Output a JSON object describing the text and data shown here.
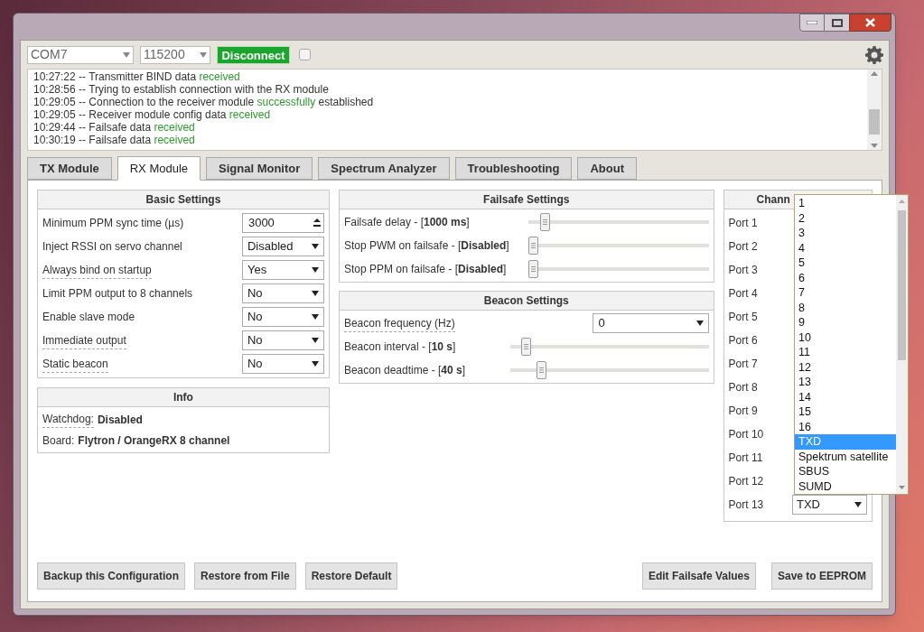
{
  "toolbar": {
    "port": "COM7",
    "baud": "115200",
    "connect_button": "Disconnect",
    "checkbox": {
      "checked": false
    }
  },
  "log": [
    [
      {
        "text": "10:27:22 -- Transmitter BIND data ",
        "kind": "plain"
      },
      {
        "text": "received",
        "kind": "ok"
      }
    ],
    [
      {
        "text": "10:28:56 -- Trying to establish connection with the RX module",
        "kind": "plain"
      }
    ],
    [
      {
        "text": "10:29:05 -- Connection to the receiver module ",
        "kind": "plain"
      },
      {
        "text": "successfully",
        "kind": "ok"
      },
      {
        "text": " established",
        "kind": "plain"
      }
    ],
    [
      {
        "text": "10:29:05 -- Receiver module config data ",
        "kind": "plain"
      },
      {
        "text": "received",
        "kind": "ok"
      }
    ],
    [
      {
        "text": "10:29:44 -- Failsafe data ",
        "kind": "plain"
      },
      {
        "text": "received",
        "kind": "ok"
      }
    ],
    [
      {
        "text": "10:30:19 -- Failsafe data ",
        "kind": "plain"
      },
      {
        "text": "received",
        "kind": "ok"
      }
    ]
  ],
  "tabs": [
    {
      "label": "TX Module",
      "selected": false
    },
    {
      "label": "RX Module",
      "selected": true
    },
    {
      "label": "Signal Monitor",
      "selected": false
    },
    {
      "label": "Spectrum Analyzer",
      "selected": false
    },
    {
      "label": "Troubleshooting",
      "selected": false
    },
    {
      "label": "About",
      "selected": false
    }
  ],
  "basic_settings": {
    "title": "Basic Settings",
    "rows": [
      {
        "label": "Minimum PPM sync time (µs)",
        "hint": false,
        "kind": "number",
        "value": "3000"
      },
      {
        "label": "Inject RSSI on servo channel",
        "hint": false,
        "kind": "select",
        "value": "Disabled"
      },
      {
        "label": "Always bind on startup",
        "hint": true,
        "kind": "select",
        "value": "Yes"
      },
      {
        "label": "Limit PPM output to 8 channels",
        "hint": false,
        "kind": "select",
        "value": "No"
      },
      {
        "label": "Enable slave mode",
        "hint": false,
        "kind": "select",
        "value": "No"
      },
      {
        "label": "Immediate output",
        "hint": true,
        "kind": "select",
        "value": "No"
      },
      {
        "label": "Static beacon",
        "hint": true,
        "kind": "select",
        "value": "No"
      }
    ]
  },
  "info": {
    "title": "Info",
    "rows": [
      {
        "label": "Watchdog:",
        "hint": true,
        "value": "Disabled"
      },
      {
        "label": "Board:",
        "hint": false,
        "value": "Flytron / OrangeRX 8 channel"
      }
    ]
  },
  "failsafe_settings": {
    "title": "Failsafe Settings",
    "rows": [
      {
        "kind": "slider",
        "label": "Failsafe delay - [**1000 ms**]",
        "level": 0.07
      },
      {
        "kind": "slider",
        "label": "Stop PWM on failsafe - [**Disabled**]",
        "level": 0
      },
      {
        "kind": "slider",
        "label": "Stop PPM on failsafe - [**Disabled**]",
        "level": 0
      }
    ]
  },
  "beacon_settings": {
    "title": "Beacon Settings",
    "rows": [
      {
        "kind": "select",
        "label": "Beacon frequency (Hz)",
        "hint": true,
        "value": "0"
      },
      {
        "kind": "slider",
        "label": "Beacon interval - [**10 s**]",
        "level": 0.06
      },
      {
        "kind": "slider",
        "label": "Beacon deadtime - [**40 s**]",
        "level": 0.14
      }
    ]
  },
  "channels": {
    "title": "Chann",
    "ports": [
      {
        "label": "Port 1"
      },
      {
        "label": "Port 2"
      },
      {
        "label": "Port 3"
      },
      {
        "label": "Port 4"
      },
      {
        "label": "Port 5"
      },
      {
        "label": "Port 6"
      },
      {
        "label": "Port 7"
      },
      {
        "label": "Port 8"
      },
      {
        "label": "Port 9"
      },
      {
        "label": "Port 10"
      },
      {
        "label": "Port 11"
      },
      {
        "label": "Port 12"
      },
      {
        "label": "Port 13",
        "value": "TXD"
      }
    ],
    "open_dropdown": [
      {
        "label": "1",
        "selected": false
      },
      {
        "label": "2",
        "selected": false
      },
      {
        "label": "3",
        "selected": false
      },
      {
        "label": "4",
        "selected": false
      },
      {
        "label": "5",
        "selected": false
      },
      {
        "label": "6",
        "selected": false
      },
      {
        "label": "7",
        "selected": false
      },
      {
        "label": "8",
        "selected": false
      },
      {
        "label": "9",
        "selected": false
      },
      {
        "label": "10",
        "selected": false
      },
      {
        "label": "11",
        "selected": false
      },
      {
        "label": "12",
        "selected": false
      },
      {
        "label": "13",
        "selected": false
      },
      {
        "label": "14",
        "selected": false
      },
      {
        "label": "15",
        "selected": false
      },
      {
        "label": "16",
        "selected": false
      },
      {
        "label": "TXD",
        "selected": true
      },
      {
        "label": "Spektrum satellite",
        "selected": false
      },
      {
        "label": "SBUS",
        "selected": false
      },
      {
        "label": "SUMD",
        "selected": false
      }
    ]
  },
  "buttons_left": [
    "Backup this Configuration",
    "Restore from File",
    "Restore Default"
  ],
  "buttons_right": [
    "Edit Failsafe Values",
    "Save to EEPROM"
  ]
}
